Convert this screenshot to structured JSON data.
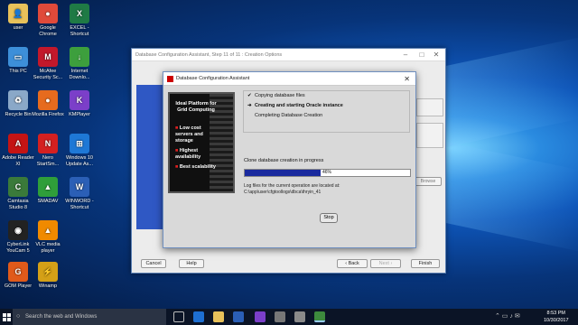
{
  "desktop_icons": [
    {
      "label": "user",
      "icon": "user-folder-icon",
      "color": "#e8c15a",
      "glyph": "👤"
    },
    {
      "label": "Google Chrome",
      "icon": "chrome-icon",
      "color": "#e04a3a",
      "glyph": "●"
    },
    {
      "label": "EXCEL - Shortcut",
      "icon": "excel-icon",
      "color": "#1f7a45",
      "glyph": "X"
    },
    {
      "label": "This PC",
      "icon": "computer-icon",
      "color": "#3d8fd9",
      "glyph": "▭"
    },
    {
      "label": "McAfee Security Sc...",
      "icon": "mcafee-icon",
      "color": "#c2182b",
      "glyph": "M"
    },
    {
      "label": "Internet Downlo...",
      "icon": "idm-icon",
      "color": "#3d9f3d",
      "glyph": "↓"
    },
    {
      "label": "Recycle Bin",
      "icon": "recycle-bin-icon",
      "color": "#8aa8c8",
      "glyph": "♻"
    },
    {
      "label": "Mozilla Firefox",
      "icon": "firefox-icon",
      "color": "#e66b1e",
      "glyph": "●"
    },
    {
      "label": "KMPlayer",
      "icon": "kmplayer-icon",
      "color": "#7b3fc9",
      "glyph": "K"
    },
    {
      "label": "Adobe Reader XI",
      "icon": "adobe-reader-icon",
      "color": "#c41414",
      "glyph": "A"
    },
    {
      "label": "Nero StartSm...",
      "icon": "nero-icon",
      "color": "#d42020",
      "glyph": "N"
    },
    {
      "label": "Windows 10 Update As...",
      "icon": "windows-update-icon",
      "color": "#1e78d6",
      "glyph": "⊞"
    },
    {
      "label": "Camtasia Studio 8",
      "icon": "camtasia-icon",
      "color": "#3a7a3a",
      "glyph": "C"
    },
    {
      "label": "SMADAV",
      "icon": "smadav-icon",
      "color": "#2f9e3a",
      "glyph": "▲"
    },
    {
      "label": "WINWORD - Shortcut",
      "icon": "word-icon",
      "color": "#2b5fb6",
      "glyph": "W"
    },
    {
      "label": "CyberLink YouCam 5",
      "icon": "youcam-icon",
      "color": "#222",
      "glyph": "◉"
    },
    {
      "label": "VLC media player",
      "icon": "vlc-icon",
      "color": "#f08a00",
      "glyph": "▲"
    },
    {
      "label": "",
      "icon": "",
      "color": "",
      "glyph": ""
    },
    {
      "label": "GOM Player",
      "icon": "gom-player-icon",
      "color": "#e05a1a",
      "glyph": "G"
    },
    {
      "label": "Winamp",
      "icon": "winamp-icon",
      "color": "#d4a017",
      "glyph": "⚡"
    },
    {
      "label": "",
      "icon": "",
      "color": "",
      "glyph": ""
    }
  ],
  "bg_window": {
    "title": "Database Configuration Assistant, Step 11 of 11 : Creation Options",
    "cancel": "Cancel",
    "help": "Help",
    "back": "Back",
    "next": "Next",
    "finish": "Finish",
    "browse": "Browse"
  },
  "dialog": {
    "title": "Database Configuration Assistant",
    "promo": {
      "heading": "Ideal Platform for Grid Computing",
      "items": [
        "Low cost servers and storage",
        "Highest availability",
        "Best scalability"
      ]
    },
    "steps": [
      {
        "mark": "✔",
        "text": "Copying database files",
        "bold": false
      },
      {
        "mark": "➜",
        "text": "Creating and starting Oracle instance",
        "bold": true
      },
      {
        "mark": "",
        "text": "Completing Database Creation",
        "bold": false
      }
    ],
    "status": "Clone database creation in progress",
    "progress_percent": 46,
    "progress_label": "46%",
    "log_line1": "Log files for the current operation are located at:",
    "log_line2": "C:\\app\\user\\cfgtoollogs\\dbca\\thryin_41",
    "stop": "Stop"
  },
  "taskbar": {
    "search_placeholder": "Search the web and Windows",
    "time": "8:53 PM",
    "date": "10/30/2017"
  }
}
